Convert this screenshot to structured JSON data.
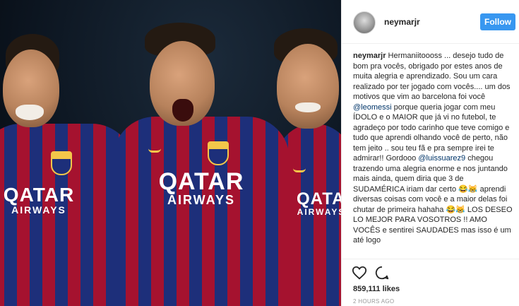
{
  "post": {
    "username": "neymarjr",
    "follow_label": "Follow",
    "caption_username": "neymarjr",
    "caption_part1": " Hermaniitoooss ... desejo tudo de bom pra vocês, obrigado por estes anos de muita alegria e aprendizado. Sou um cara realizado por ter jogado com vocês.... um dos motivos que vim ao barcelona foi você ",
    "mention1": "@leomessi",
    "caption_part2": " porque queria jogar com meu ÍDOLO e o MAIOR que já vi no futebol, te agradeço por todo carinho que teve comigo e tudo que aprendi olhando você de perto, não tem jeito .. sou teu fã e pra sempre irei te admirar!! Gordooo ",
    "mention2": "@luissuarez9",
    "caption_part3": " chegou trazendo uma alegria enorme e nos juntando mais ainda, quem diria que 3 de SUDAMÉRICA iriam dar certo 😂😹 aprendi diversas coisas com você e a maior delas foi chutar de primeira hahaha 😂😹 LOS DESEO LO MEJOR PARA VOSOTROS !! AMO VOCÊS e sentirei SAUDADES mas isso é um até logo",
    "likes": "859,111 likes",
    "timestamp": "2 HOURS AGO"
  },
  "photo": {
    "sponsor_big": "QATAR",
    "sponsor_small": "AIRWAYS"
  },
  "icons": {
    "like": "heart-icon",
    "comment": "comment-icon"
  },
  "colors": {
    "follow_button": "#3897f0",
    "jersey_blue": "#1d2f7a",
    "jersey_red": "#a5122f"
  }
}
